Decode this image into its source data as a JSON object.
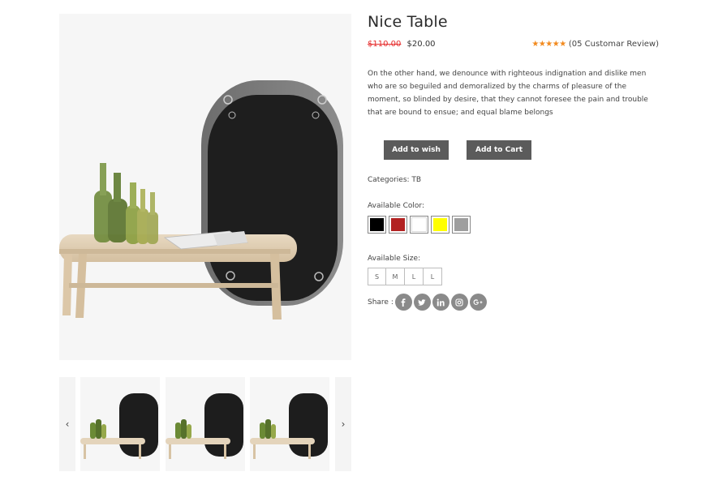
{
  "product": {
    "title": "Nice Table",
    "old_price": "$110.00",
    "new_price": "$20.00",
    "rating_stars": "★★★★★",
    "rating_value": 5,
    "review_text": "(05 Customar Review)",
    "description": "On the other hand, we denounce with righteous indignation and dislike men who are so beguiled and demoralized by the charms of pleasure of the moment, so blinded by desire, that they cannot foresee the pain and trouble that are bound to ensue; and equal blame belongs"
  },
  "actions": {
    "wish_label": "Add to wish",
    "cart_label": "Add to Cart"
  },
  "meta": {
    "categories": "Categories: TB",
    "color_label": "Available Color:",
    "size_label": "Available Size:",
    "share_label": "Share :"
  },
  "colors": [
    "#000000",
    "#b22222",
    "#ffffff",
    "#ffff00",
    "#9e9e9e"
  ],
  "sizes": [
    "S",
    "M",
    "L",
    "L"
  ],
  "social": [
    "facebook-icon",
    "twitter-icon",
    "linkedin-icon",
    "instagram-icon",
    "google-plus-icon"
  ],
  "thumbnails": {
    "prev_icon": "‹",
    "next_icon": "›"
  }
}
